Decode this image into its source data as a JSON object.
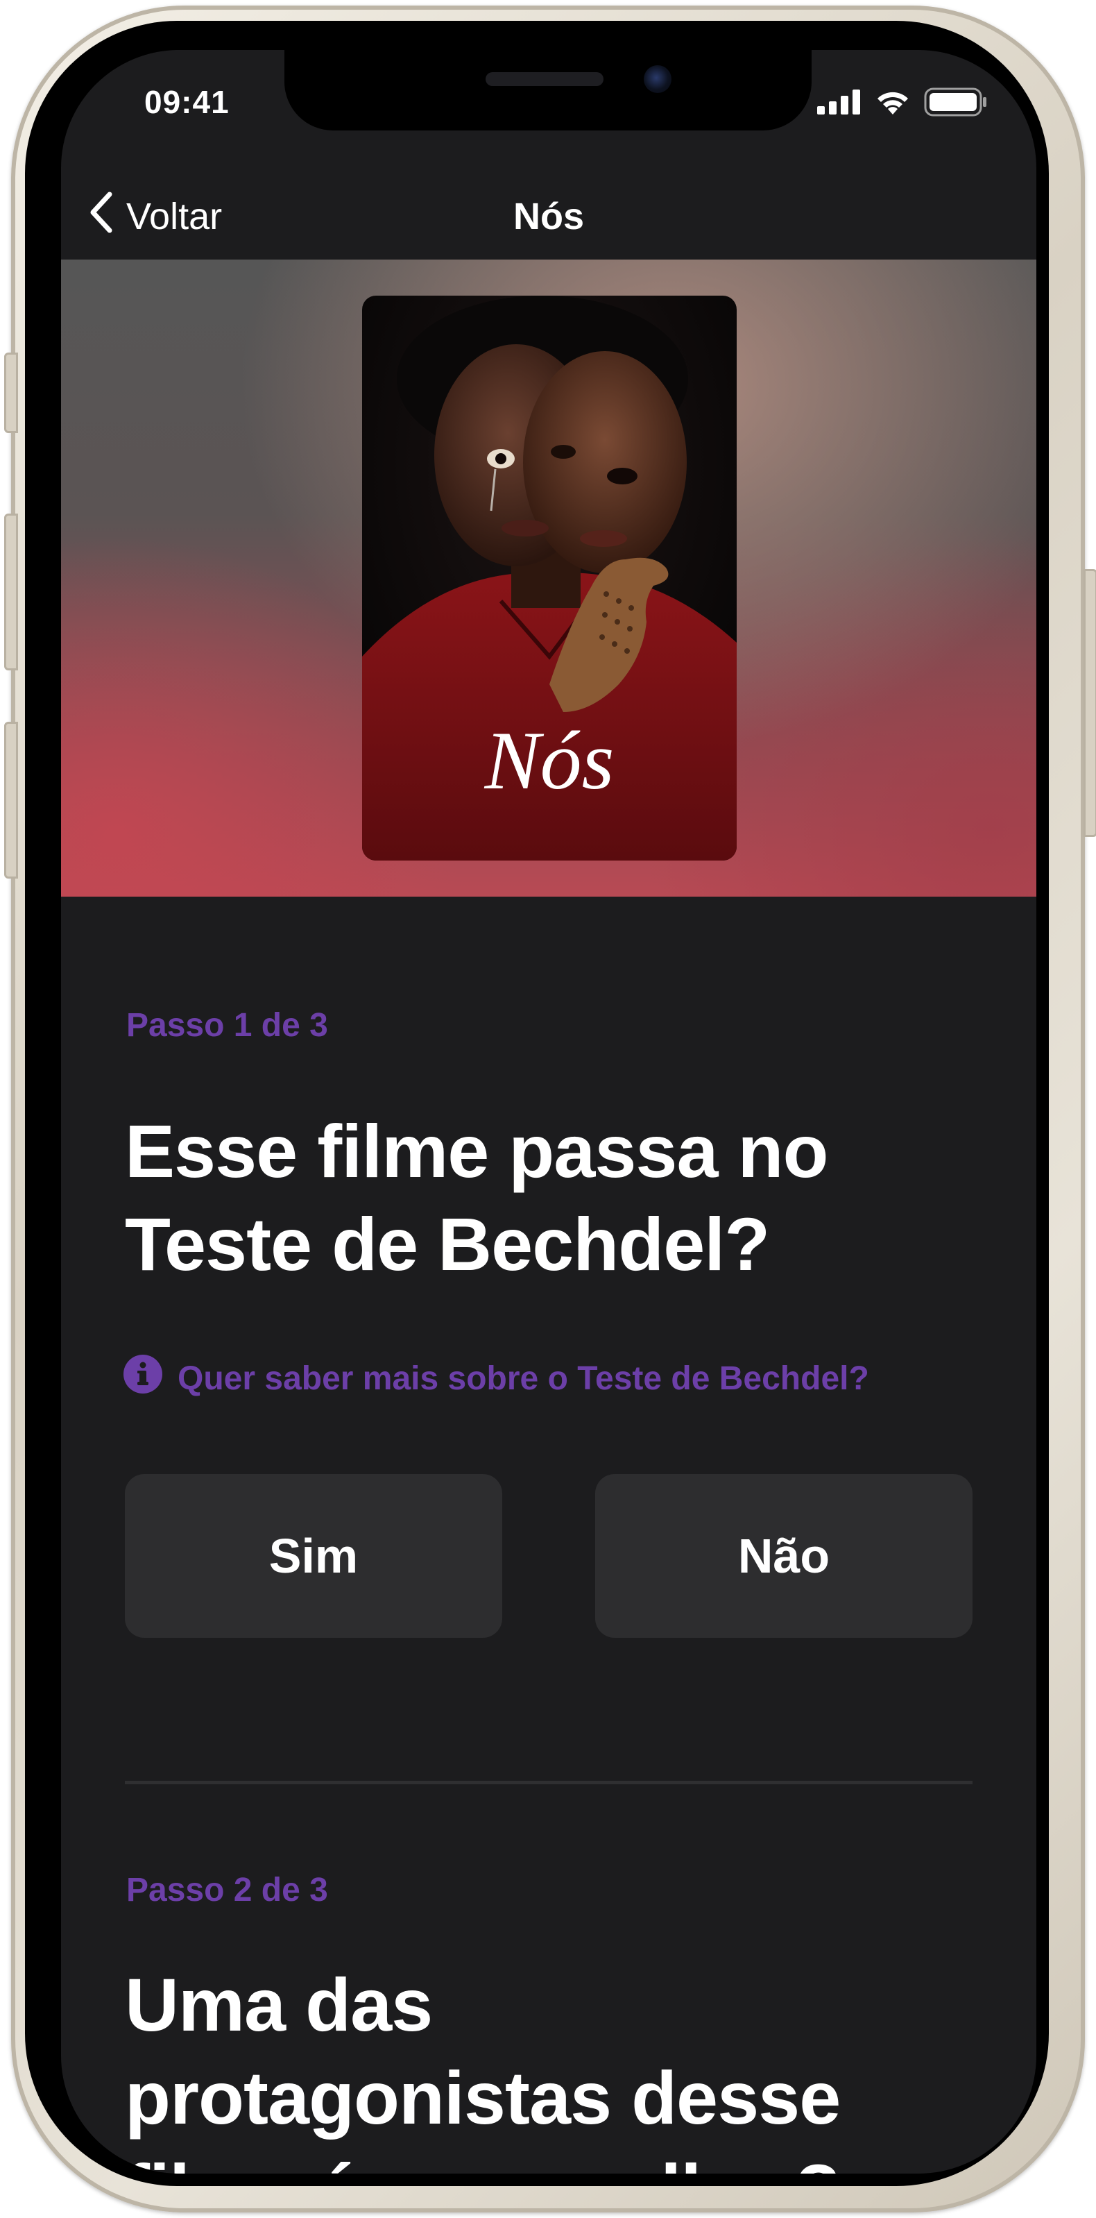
{
  "status_bar": {
    "time": "09:41",
    "icons": [
      "cellular-signal-icon",
      "wifi-icon",
      "battery-icon"
    ]
  },
  "nav": {
    "back_label": "Voltar",
    "title": "Nós"
  },
  "hero": {
    "poster_title": "Nós"
  },
  "steps": [
    {
      "label": "Passo 1 de 3",
      "question": "Esse filme passa no Teste de Bechdel?",
      "info_link": "Quer saber mais sobre o Teste de Bechdel?",
      "options": [
        "Sim",
        "Não"
      ]
    },
    {
      "label": "Passo 2 de 3",
      "question_line1": "Uma das",
      "question_line2": "protagonistas desse",
      "question_line3_start": "filme é ",
      "question_line3_struck": "uma mul",
      "question_line3_end": "her?"
    }
  ],
  "colors": {
    "accent": "#6c3fa8",
    "background": "#1c1c1e",
    "button": "#2d2d2f",
    "text": "#ffffff"
  }
}
